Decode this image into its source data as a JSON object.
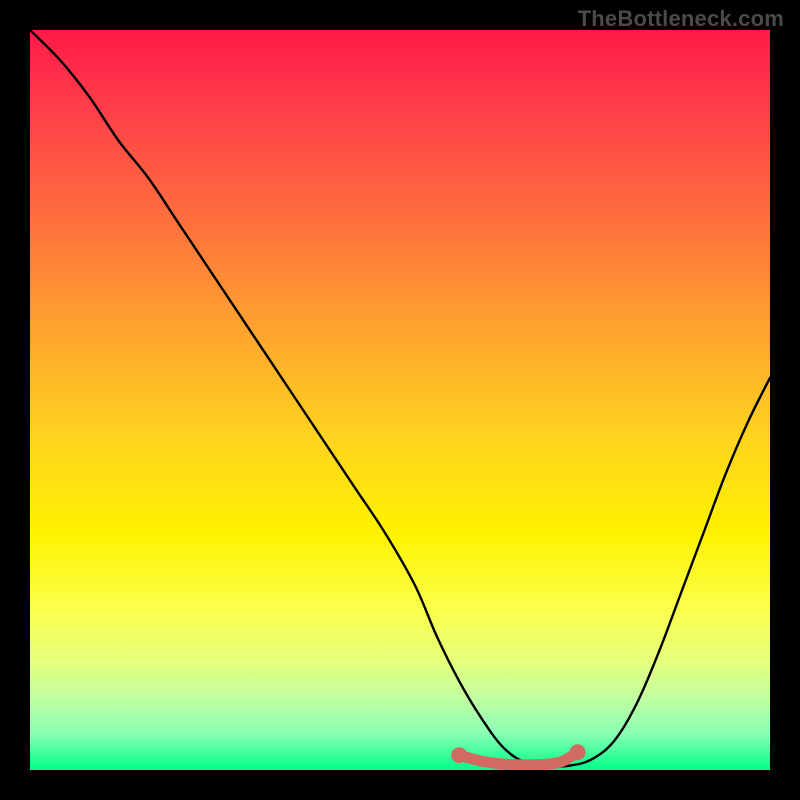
{
  "watermark": "TheBottleneck.com",
  "chart_data": {
    "type": "line",
    "title": "",
    "xlabel": "",
    "ylabel": "",
    "xlim": [
      0,
      100
    ],
    "ylim": [
      0,
      100
    ],
    "series": [
      {
        "name": "curve",
        "color": "#000000",
        "x": [
          0,
          4,
          8,
          12,
          16,
          20,
          24,
          28,
          32,
          36,
          40,
          44,
          48,
          52,
          55,
          58,
          61,
          64,
          67,
          70,
          73,
          76,
          79,
          82,
          85,
          88,
          91,
          94,
          97,
          100
        ],
        "y": [
          100,
          96,
          91,
          85,
          80,
          74,
          68,
          62,
          56,
          50,
          44,
          38,
          32,
          25,
          18,
          12,
          7,
          3,
          1,
          0.5,
          0.6,
          1.5,
          4,
          9,
          16,
          24,
          32,
          40,
          47,
          53
        ]
      },
      {
        "name": "highlight",
        "color": "#d26a62",
        "x": [
          58,
          61,
          64,
          67,
          70,
          72,
          74
        ],
        "y": [
          2.0,
          1.2,
          0.8,
          0.7,
          0.8,
          1.2,
          2.4
        ]
      }
    ],
    "highlight_endpoints": {
      "start": {
        "x": 58,
        "y": 2.0
      },
      "end": {
        "x": 74,
        "y": 2.4
      }
    }
  }
}
